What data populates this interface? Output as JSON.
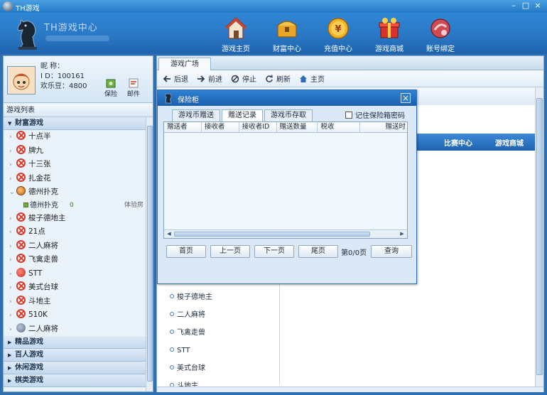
{
  "window": {
    "title": "TH游戏"
  },
  "header": {
    "logo_text": "TH游戏中心",
    "nav": [
      {
        "label": "游戏主页",
        "icon": "home-icon"
      },
      {
        "label": "财富中心",
        "icon": "treasure-chest-icon"
      },
      {
        "label": "充值中心",
        "icon": "coin-icon"
      },
      {
        "label": "游戏商城",
        "icon": "gift-box-icon"
      },
      {
        "label": "账号绑定",
        "icon": "account-bind-icon"
      }
    ]
  },
  "profile": {
    "nickname_label": "昵    称：",
    "id_label": "I    D：",
    "id_value": "100161",
    "beans_label": "欢乐豆：",
    "beans_value": "4800",
    "safe_label": "保险",
    "mail_label": "邮件"
  },
  "game_list": {
    "title": "游戏列表",
    "categories": [
      {
        "label": "财富游戏",
        "expanded": true
      },
      {
        "label": "精品游戏",
        "expanded": false
      },
      {
        "label": "百人游戏",
        "expanded": false
      },
      {
        "label": "休闲游戏",
        "expanded": false
      },
      {
        "label": "棋类游戏",
        "expanded": false
      }
    ],
    "games": [
      {
        "label": "十点半",
        "icon": "red"
      },
      {
        "label": "牌九",
        "icon": "red"
      },
      {
        "label": "十三张",
        "icon": "red"
      },
      {
        "label": "扎金花",
        "icon": "red"
      },
      {
        "label": "德州扑克",
        "icon": "orange"
      },
      {
        "label": "梭子德地主",
        "icon": "red"
      },
      {
        "label": "21点",
        "icon": "red"
      },
      {
        "label": "二人麻将",
        "icon": "red"
      },
      {
        "label": "飞禽走兽",
        "icon": "red"
      },
      {
        "label": "STT",
        "icon": "stt"
      },
      {
        "label": "美式台球",
        "icon": "red"
      },
      {
        "label": "斗地主",
        "icon": "red"
      },
      {
        "label": "510K",
        "icon": "red"
      },
      {
        "label": "二人麻将",
        "icon": "other"
      }
    ],
    "subroom": {
      "label": "德州扑克",
      "players": "0",
      "status": "体验房"
    }
  },
  "browser": {
    "tab": "游戏广场",
    "toolbar": {
      "back": "后退",
      "forward": "前进",
      "stop": "停止",
      "refresh": "刷新",
      "home": "主页"
    },
    "nav_items": [
      "比赛中心",
      "游戏商城"
    ],
    "quick_links": [
      "梭子德地主",
      "二人麻将",
      "飞禽走兽",
      "STT",
      "美式台球",
      "斗地主"
    ]
  },
  "dialog": {
    "title": "保险柜",
    "tabs": [
      "游戏币赠送",
      "赠送记录",
      "游戏币存取"
    ],
    "active_tab": 1,
    "remember_label": "记住保险箱密码",
    "remember_checked": false,
    "columns": [
      "赠送者",
      "接收者",
      "接收者ID",
      "赠送数量",
      "税收",
      "赠送时"
    ],
    "rows": [],
    "pager": {
      "first": "首页",
      "prev": "上一页",
      "next": "下一页",
      "last": "尾页",
      "info": "第0/0页",
      "query": "查询"
    }
  }
}
